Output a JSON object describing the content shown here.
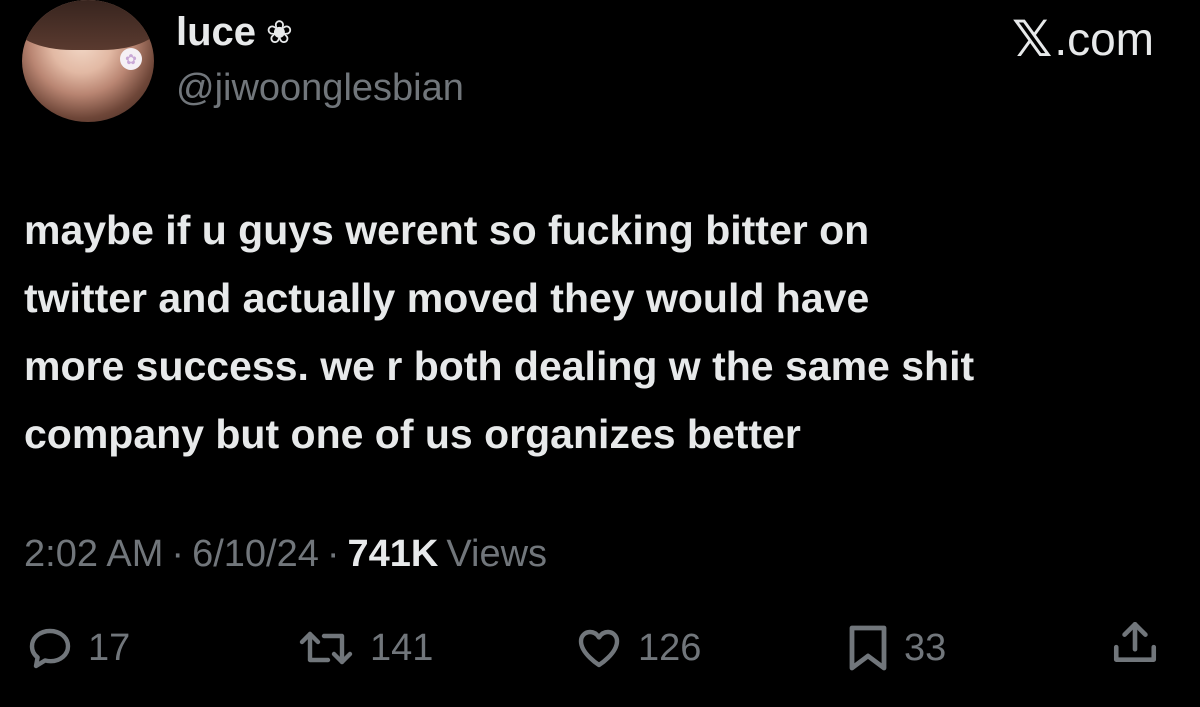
{
  "user": {
    "display_name": "luce",
    "name_flower": "❀",
    "handle": "@jiwoonglesbian"
  },
  "brand": {
    "x_mark": "𝕏",
    "domain": ".com"
  },
  "tweet": {
    "text": "maybe if u guys werent so fucking bitter on\ntwitter and actually moved they would have\nmore success. we r both dealing w the same shit\ncompany but one of us organizes better"
  },
  "meta": {
    "time": "2:02 AM",
    "separator": "·",
    "date": "6/10/24",
    "views_count": "741K",
    "views_label": "Views"
  },
  "actions": {
    "replies": "17",
    "reposts": "141",
    "likes": "126",
    "bookmarks": "33"
  },
  "colors": {
    "background": "#000000",
    "primary_text": "#e7e9ea",
    "secondary_text": "#71767b"
  }
}
